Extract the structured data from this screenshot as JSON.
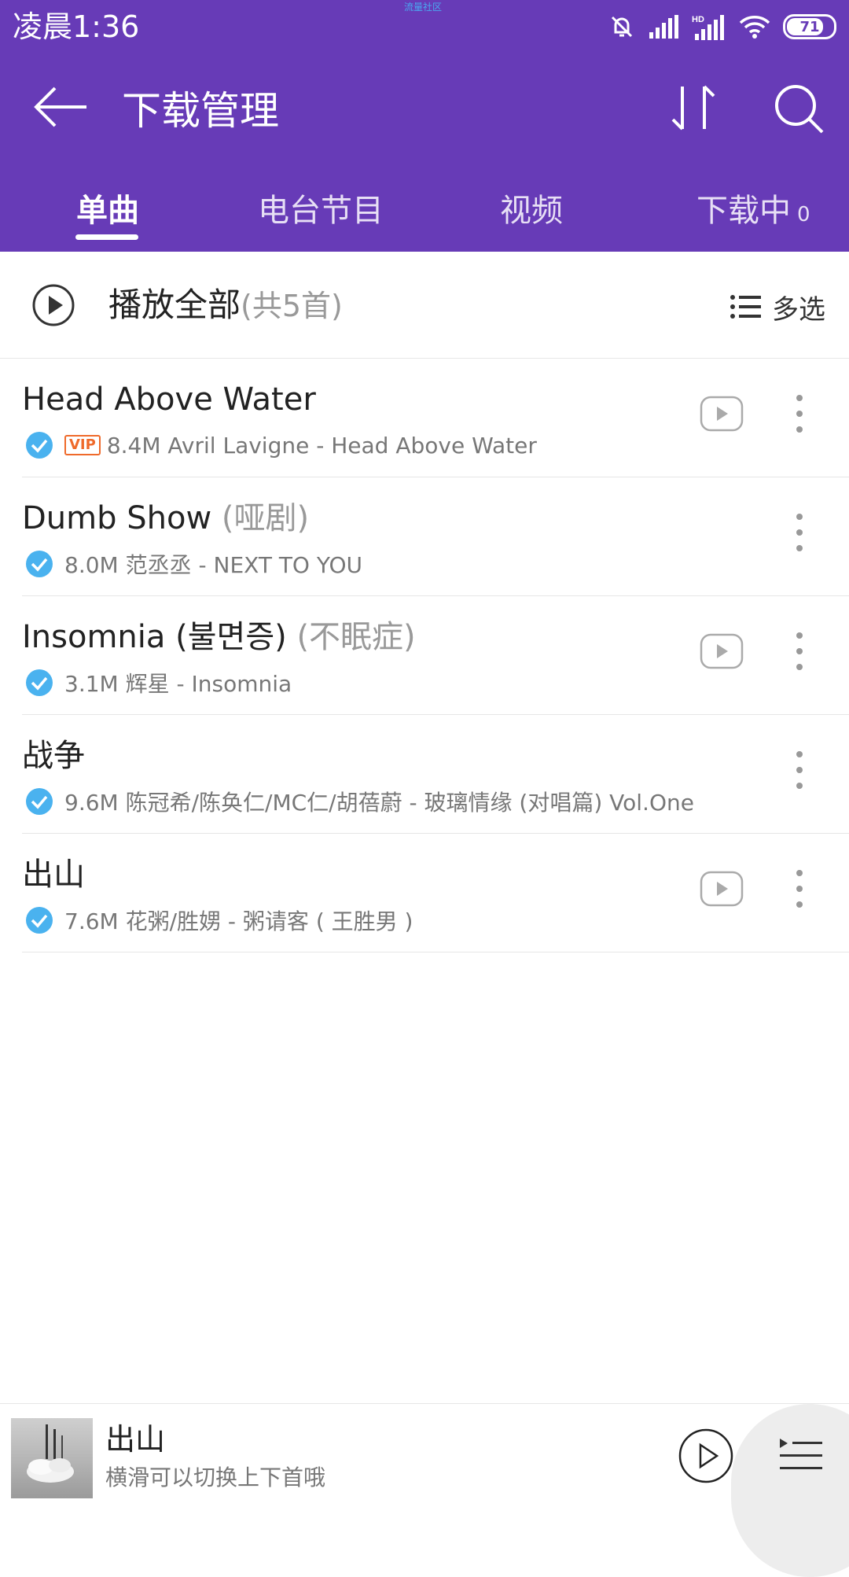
{
  "status": {
    "time": "凌晨1:36",
    "center_text": "流量社区",
    "battery": "71"
  },
  "header": {
    "title": "下载管理"
  },
  "tabs": [
    {
      "label": "单曲"
    },
    {
      "label": "电台节目"
    },
    {
      "label": "视频"
    },
    {
      "label": "下载中",
      "count": "0"
    }
  ],
  "play_all": {
    "label": "播放全部",
    "count_text": "(共5首)",
    "multiselect_label": "多选"
  },
  "songs": [
    {
      "title": "Head Above Water",
      "subtitle": "",
      "vip": "VIP",
      "meta": "8.4M Avril Lavigne - Head Above Water"
    },
    {
      "title": "Dumb Show",
      "subtitle": "(哑剧)",
      "meta": "8.0M 范丞丞 - NEXT TO YOU"
    },
    {
      "title": "Insomnia (불면증)",
      "subtitle": "(不眠症)",
      "meta": "3.1M 辉星 - Insomnia"
    },
    {
      "title": "战争",
      "subtitle": "",
      "meta": "9.6M 陈冠希/陈奂仁/MC仁/胡蓓蔚 - 玻璃情缘 (对唱篇) Vol.One"
    },
    {
      "title": "出山",
      "subtitle": "",
      "meta": "7.6M 花粥/胜娚 - 粥请客 ( 王胜男 )"
    }
  ],
  "now_playing": {
    "title": "出山",
    "hint": "横滑可以切换上下首哦"
  },
  "colors": {
    "primary": "#673bb7",
    "check": "#4ab2ef",
    "vip": "#ef6a2b"
  }
}
